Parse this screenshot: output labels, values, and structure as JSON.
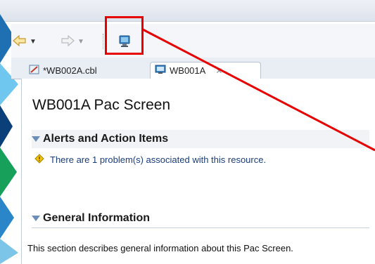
{
  "toolbar": {
    "back_icon": "back-arrow-icon",
    "forward_icon": "forward-arrow-icon",
    "highlighted_icon": "screen-preview-icon"
  },
  "tabs": [
    {
      "label": "*WB002A.cbl",
      "icon": "cobol-edit-icon"
    },
    {
      "label": "WB001A",
      "icon": "pac-screen-icon",
      "close": "✕"
    }
  ],
  "page": {
    "title": "WB001A Pac Screen",
    "alerts_section": "Alerts and Action Items",
    "alert_message": "There are 1 problem(s) associated with this resource.",
    "general_section": "General Information",
    "description": "This section describes general information about this Pac Screen."
  },
  "colors": {
    "highlight": "#e60000",
    "accent": "#1b3d7a"
  }
}
